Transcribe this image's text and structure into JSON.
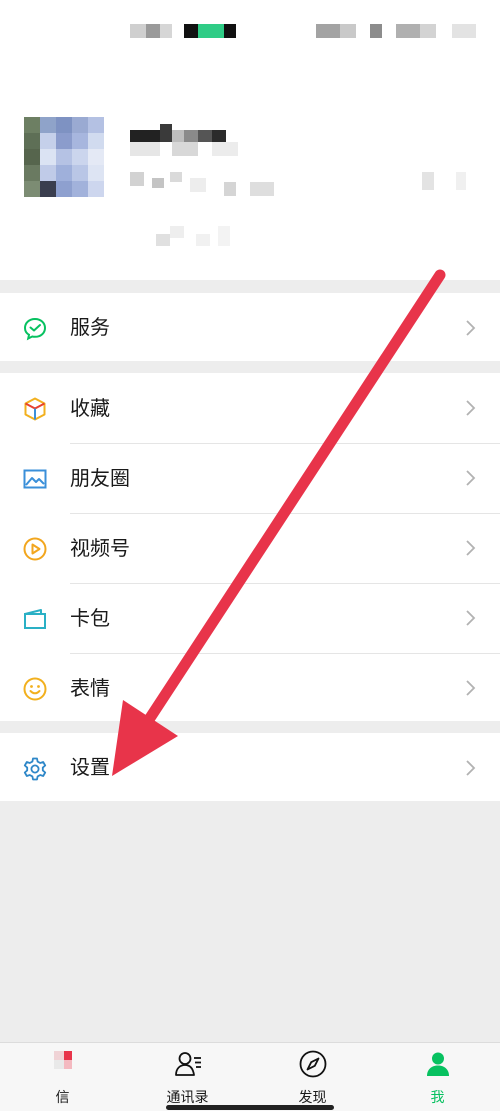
{
  "menu": {
    "services": {
      "label": "服务",
      "icon": "wechat-pay-icon"
    },
    "items": [
      {
        "label": "收藏",
        "icon": "favorites-cube-icon"
      },
      {
        "label": "朋友圈",
        "icon": "moments-picture-icon"
      },
      {
        "label": "视频号",
        "icon": "channels-play-icon"
      },
      {
        "label": "卡包",
        "icon": "card-wallet-icon"
      },
      {
        "label": "表情",
        "icon": "sticker-smile-icon"
      }
    ],
    "settings": {
      "label": "设置",
      "icon": "gear-icon"
    }
  },
  "tabbar": {
    "tabs": [
      {
        "label": "信",
        "icon": "chat-icon"
      },
      {
        "label": "通讯录",
        "icon": "contacts-icon"
      },
      {
        "label": "发现",
        "icon": "compass-icon"
      },
      {
        "label": "我",
        "icon": "me-icon",
        "active": true
      }
    ]
  },
  "colors": {
    "accent_green": "#07c160",
    "arrow_red": "#e8344a",
    "settings_blue": "#2e87c8"
  }
}
